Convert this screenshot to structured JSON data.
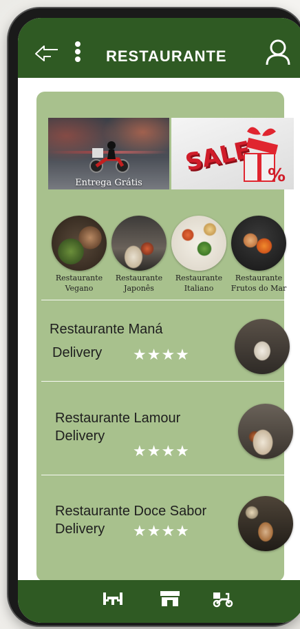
{
  "header": {
    "title": "RESTAURANTE",
    "back_icon": "back-arrow-icon",
    "menu_icon": "kebab-menu-icon",
    "user_icon": "user-icon"
  },
  "banners": [
    {
      "label": "Entrega Grátis",
      "image": "delivery-motorcycle"
    },
    {
      "label": "SALE",
      "image": "sale-gift-box"
    }
  ],
  "categories": [
    {
      "line1": "Restaurante",
      "line2": "Vegano"
    },
    {
      "line1": "Restaurante",
      "line2": "Japonês"
    },
    {
      "line1": "Restaurante",
      "line2": "Italiano"
    },
    {
      "line1": "Restaurante",
      "line2": "Frutos do Mar"
    }
  ],
  "restaurants": [
    {
      "name": "Restaurante Maná",
      "sub": "Delivery",
      "stars": "★★★★",
      "rating": 4
    },
    {
      "name": "Restaurante  Lamour",
      "sub": "Delivery",
      "stars": "★★★★",
      "rating": 4
    },
    {
      "name": "Restaurante Doce Sabor",
      "sub": "Delivery",
      "stars": "★★★★",
      "rating": 4
    }
  ],
  "bottom_nav": [
    "restaurant-table-icon",
    "store-icon",
    "delivery-scooter-icon"
  ],
  "colors": {
    "header": "#2f5a23",
    "panel": "#a8c18d",
    "sale_red": "#d01d2a"
  }
}
